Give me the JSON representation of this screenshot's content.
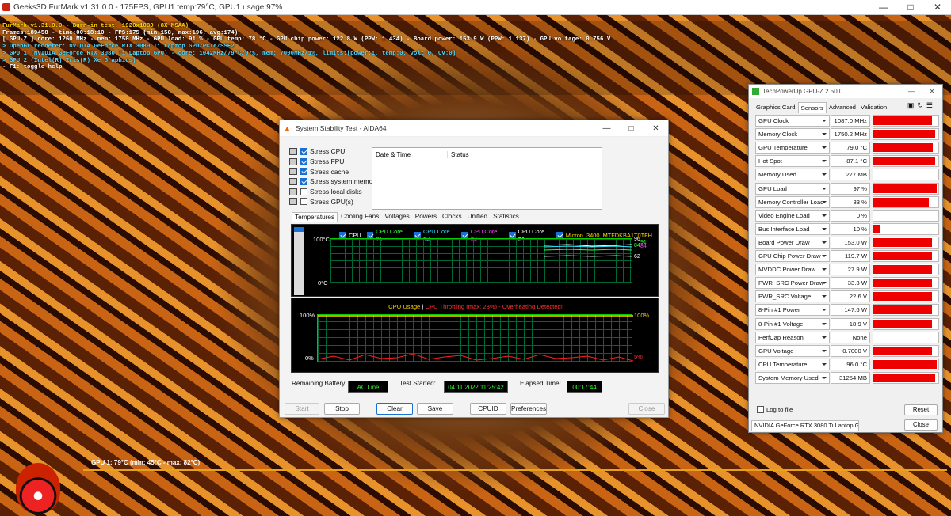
{
  "furmark": {
    "title": "Geeks3D FurMark v1.31.0.0 - 175FPS, GPU1 temp:79°C, GPU1 usage:97%",
    "osd": [
      "FurMark v1.31.0.0 - Burn-in test, 1920x1080 (8X MSAA)",
      "Frames:189458 - time:00:18:10 - FPS:175 (min:158, max:196, avg:174)",
      "[ GPU-Z ] core: 1260 MHz - mem: 1750 MHz - GPU load: 91 % - GPU temp: 78 °C - GPU chip power: 122.8 W (PPW: 1.434) - Board power: 153.9 W (PPW: 1.137) - GPU voltage: 0.756 V",
      "> OpenGL renderer: NVIDIA GeForce RTX 3080 Ti Laptop GPU/PCIe/SSE2",
      "> GPU 1 (NVIDIA GeForce RTX 3080 Ti Laptop GPU) - core: 1042MHz/79°C/97%, mem: 7000MHz/1%, limits:[power:1, temp:0, volt:0, OV:0]",
      "> GPU 2 (Intel(R) Iris(R) Xe Graphics)",
      "- F1: toggle help"
    ],
    "gpu_line": "GPU 1: 79°C (min: 45°C - max: 82°C)"
  },
  "aida": {
    "title": "System Stability Test - AIDA64",
    "stress": [
      {
        "label": "Stress CPU",
        "checked": true
      },
      {
        "label": "Stress FPU",
        "checked": true
      },
      {
        "label": "Stress cache",
        "checked": true
      },
      {
        "label": "Stress system memory",
        "checked": true
      },
      {
        "label": "Stress local disks",
        "checked": false
      },
      {
        "label": "Stress GPU(s)",
        "checked": false
      }
    ],
    "log_headers": [
      "Date & Time",
      "Status"
    ],
    "tabs": [
      "Temperatures",
      "Cooling Fans",
      "Voltages",
      "Powers",
      "Clocks",
      "Unified",
      "Statistics"
    ],
    "temp_legend": [
      {
        "label": "CPU",
        "color": "#ffffff"
      },
      {
        "label": "CPU Core #1",
        "color": "#33ff33"
      },
      {
        "label": "CPU Core #2",
        "color": "#33ddff"
      },
      {
        "label": "CPU Core #3",
        "color": "#ff44ff"
      },
      {
        "label": "CPU Core #4",
        "color": "#ffffff"
      },
      {
        "label": "Micron_3400_MTFDKBA1T0TFH",
        "color": "#ffd400"
      }
    ],
    "temp_axis": {
      "top": "100°C",
      "bottom": "0°C"
    },
    "temp_values": [
      "96",
      "91",
      "84",
      "84",
      "62"
    ],
    "cpu_title": "CPU Usage",
    "cpu_sep": "|",
    "cpu_throttle": "CPU Throttling (max: 28%) - Overheating Detected!",
    "cpu_axis": {
      "top_left": "100%",
      "bottom_left": "0%",
      "top_right": "100%",
      "bottom_right": "5%"
    },
    "status": {
      "battery_label": "Remaining Battery:",
      "battery": "AC Line",
      "started_label": "Test Started:",
      "started": "04.11.2022 11:25:42",
      "elapsed_label": "Elapsed Time:",
      "elapsed": "00:17:44"
    },
    "buttons": {
      "start": "Start",
      "stop": "Stop",
      "clear": "Clear",
      "save": "Save",
      "cpuid": "CPUID",
      "prefs": "Preferences",
      "close": "Close"
    }
  },
  "gpuz": {
    "title": "TechPowerUp GPU-Z 2.50.0",
    "tabs": [
      "Graphics Card",
      "Sensors",
      "Advanced",
      "Validation"
    ],
    "sensors": [
      {
        "label": "GPU Clock",
        "value": "1087.0 MHz",
        "fill": 0.9
      },
      {
        "label": "Memory Clock",
        "value": "1750.2 MHz",
        "fill": 0.95
      },
      {
        "label": "GPU Temperature",
        "value": "79.0 °C",
        "fill": 0.92
      },
      {
        "label": "Hot Spot",
        "value": "87.1 °C",
        "fill": 0.95
      },
      {
        "label": "Memory Used",
        "value": "277 MB",
        "fill": 0.0
      },
      {
        "label": "GPU Load",
        "value": "97 %",
        "fill": 0.97
      },
      {
        "label": "Memory Controller Load",
        "value": "83 %",
        "fill": 0.85
      },
      {
        "label": "Video Engine Load",
        "value": "0 %",
        "fill": 0.0
      },
      {
        "label": "Bus Interface Load",
        "value": "10 %",
        "fill": 0.1
      },
      {
        "label": "Board Power Draw",
        "value": "153.0 W",
        "fill": 0.9
      },
      {
        "label": "GPU Chip Power Draw",
        "value": "119.7 W",
        "fill": 0.9
      },
      {
        "label": "MVDDC Power Draw",
        "value": "27.9 W",
        "fill": 0.9
      },
      {
        "label": "PWR_SRC Power Draw",
        "value": "33.3 W",
        "fill": 0.9
      },
      {
        "label": "PWR_SRC Voltage",
        "value": "22.6 V",
        "fill": 0.9
      },
      {
        "label": "8-Pin #1 Power",
        "value": "147.6 W",
        "fill": 0.9
      },
      {
        "label": "8-Pin #1 Voltage",
        "value": "18.9 V",
        "fill": 0.9
      },
      {
        "label": "PerfCap Reason",
        "value": "None",
        "fill": 0.0
      },
      {
        "label": "GPU Voltage",
        "value": "0.7000 V",
        "fill": 0.9
      },
      {
        "label": "CPU Temperature",
        "value": "96.0 °C",
        "fill": 0.97
      },
      {
        "label": "System Memory Used",
        "value": "31254 MB",
        "fill": 0.95
      }
    ],
    "log_to_file": "Log to file",
    "reset": "Reset",
    "device": "NVIDIA GeForce RTX 3080 Ti Laptop G",
    "close": "Close"
  }
}
